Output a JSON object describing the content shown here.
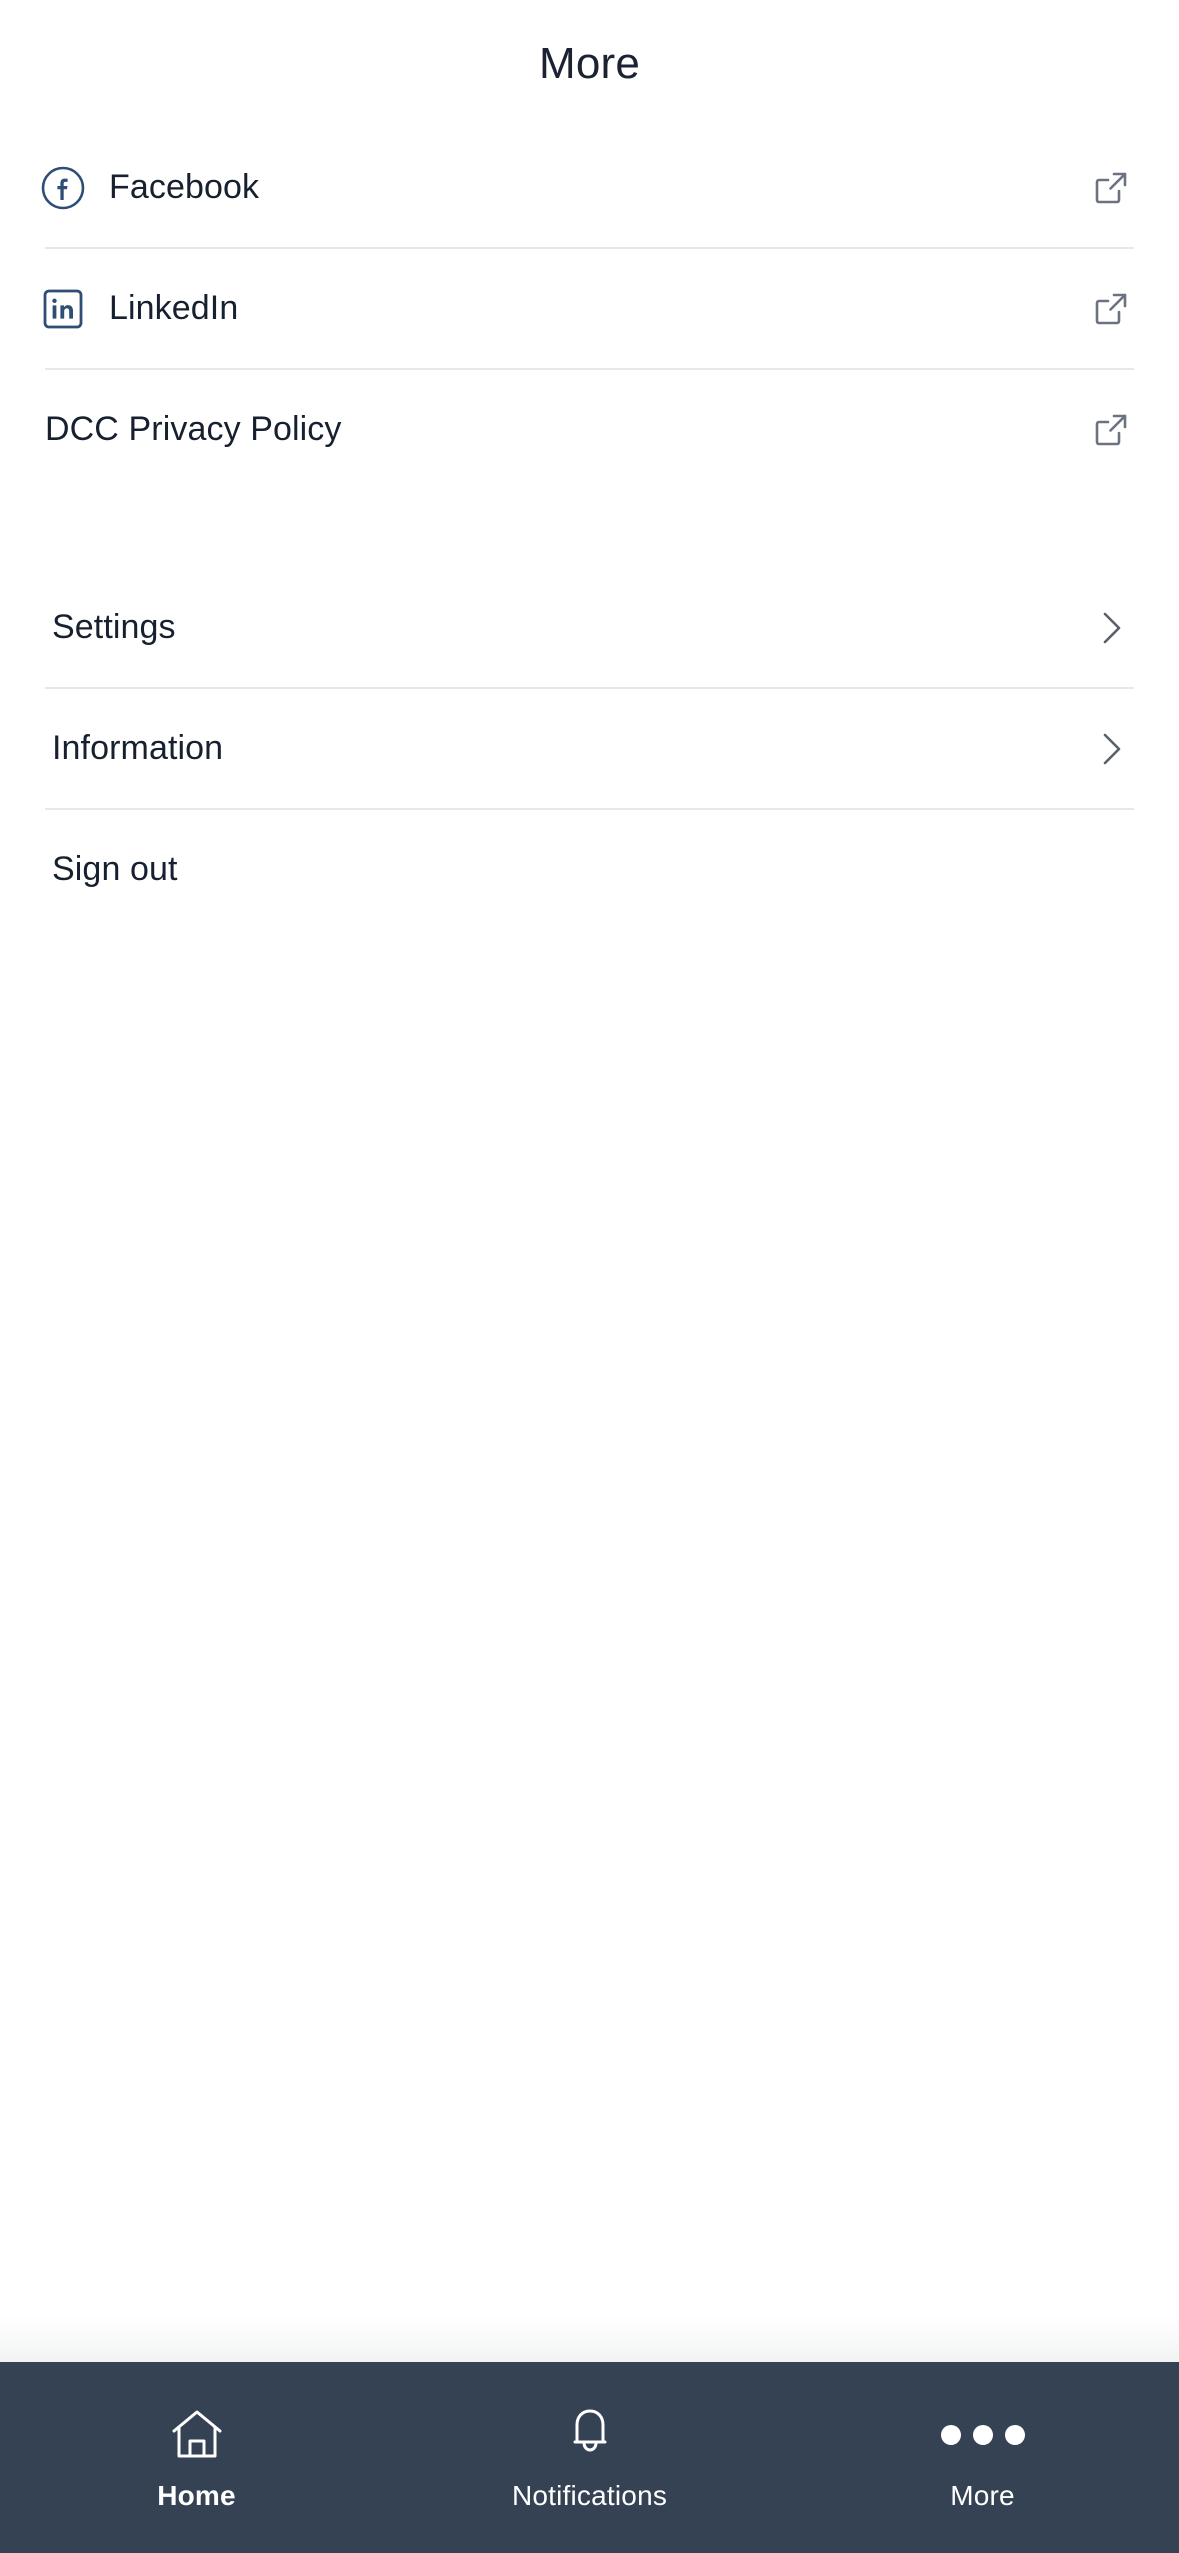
{
  "header": {
    "title": "More"
  },
  "colors": {
    "text_primary": "#17202e",
    "brand_navy": "#2f4e76",
    "icon_gray": "#6b7280",
    "divider": "#e6e7e9",
    "navbar_bg": "#354254"
  },
  "social_section": {
    "items": [
      {
        "label": "Facebook",
        "icon": "facebook-icon",
        "action_icon": "external-link-icon",
        "has_icon": true
      },
      {
        "label": "LinkedIn",
        "icon": "linkedin-icon",
        "action_icon": "external-link-icon",
        "has_icon": true
      },
      {
        "label": "DCC Privacy Policy",
        "icon": "",
        "action_icon": "external-link-icon",
        "has_icon": false
      }
    ]
  },
  "account_section": {
    "items": [
      {
        "label": "Settings",
        "action_icon": "chevron-right-icon"
      },
      {
        "label": "Information",
        "action_icon": "chevron-right-icon"
      },
      {
        "label": "Sign out",
        "action_icon": ""
      }
    ]
  },
  "bottom_nav": {
    "items": [
      {
        "label": "Home",
        "icon": "home-icon",
        "active": false
      },
      {
        "label": "Notifications",
        "icon": "bell-icon",
        "active": false
      },
      {
        "label": "More",
        "icon": "ellipsis-icon",
        "active": true
      }
    ]
  }
}
